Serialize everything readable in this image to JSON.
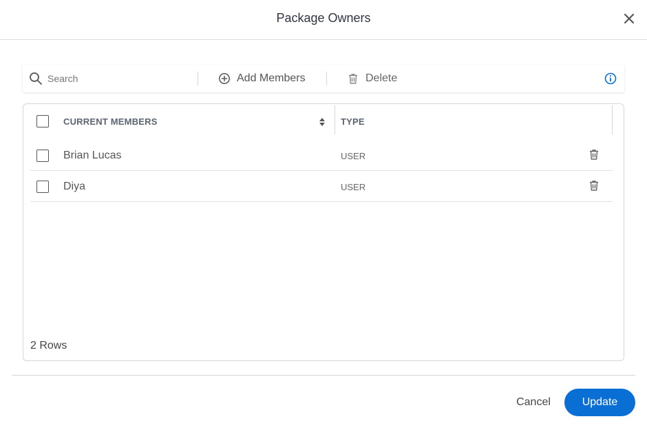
{
  "dialog": {
    "title": "Package Owners",
    "close_icon": "close-icon"
  },
  "toolbar": {
    "search_placeholder": "Search",
    "search_value": "",
    "add_members_label": "Add Members",
    "delete_label": "Delete",
    "icons": [
      "search-icon",
      "add-circle-icon",
      "trash-icon",
      "info-icon"
    ]
  },
  "table": {
    "columns": [
      "CURRENT MEMBERS",
      "TYPE"
    ],
    "rows": [
      {
        "name": "Brian Lucas",
        "type": "USER"
      },
      {
        "name": "Diya",
        "type": "USER"
      }
    ],
    "row_count": "2 Rows"
  },
  "footer": {
    "cancel_label": "Cancel",
    "update_label": "Update"
  },
  "colors": {
    "accent": "#0a6fd4",
    "info": "#0a6fd4",
    "border": "#d6d6d6",
    "header_text": "#5b6470"
  }
}
